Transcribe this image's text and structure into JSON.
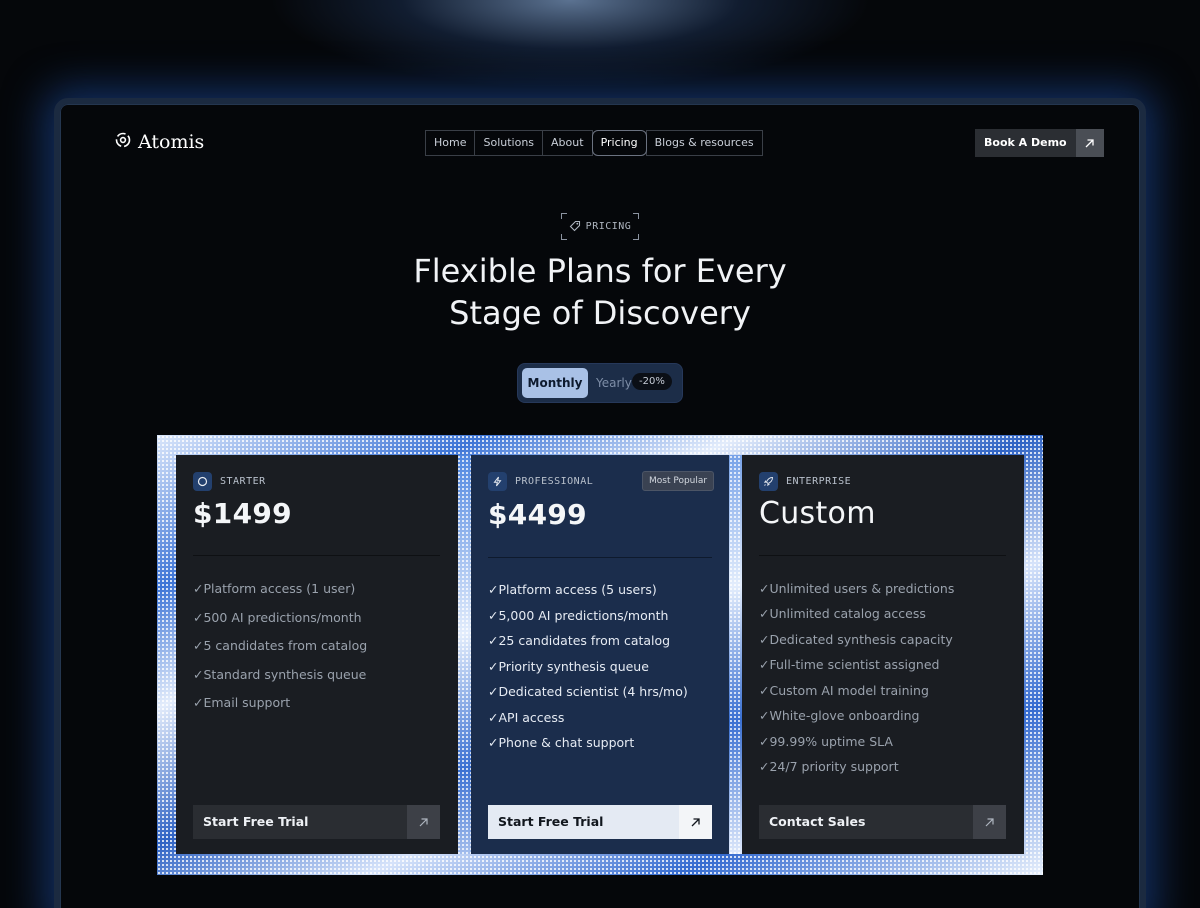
{
  "brand": {
    "name": "Atomis"
  },
  "nav": {
    "items": [
      "Home",
      "Solutions",
      "About",
      "Pricing",
      "Blogs & resources"
    ],
    "active": "Pricing"
  },
  "header_cta": {
    "label": "Book A Demo"
  },
  "hero": {
    "eyebrow": "PRICING",
    "title_line1": "Flexible Plans for Every",
    "title_line2": "Stage of Discovery"
  },
  "billing_toggle": {
    "monthly": "Monthly",
    "yearly": "Yearly",
    "yearly_badge": "-20%",
    "selected": "Monthly"
  },
  "plans": [
    {
      "name": "STARTER",
      "price": "$1499",
      "badge": "",
      "icon": "circle-icon",
      "features": [
        "Platform access (1 user)",
        "500 AI predictions/month",
        "5 candidates from catalog",
        "Standard synthesis queue",
        "Email support"
      ],
      "cta": "Start Free Trial"
    },
    {
      "name": "PROFESSIONAL",
      "price": "$4499",
      "badge": "Most Popular",
      "icon": "lightning-icon",
      "features": [
        "Platform access (5 users)",
        "5,000 AI predictions/month",
        "25 candidates from catalog",
        "Priority synthesis queue",
        "Dedicated scientist (4 hrs/mo)",
        "API access",
        "Phone & chat support"
      ],
      "cta": "Start Free Trial"
    },
    {
      "name": "ENTERPRISE",
      "price": "Custom",
      "badge": "",
      "icon": "rocket-icon",
      "features": [
        "Unlimited users & predictions",
        "Unlimited catalog access",
        "Dedicated synthesis capacity",
        "Full-time scientist assigned",
        "Custom AI model training",
        "White-glove onboarding",
        "99.99% uptime SLA",
        "24/7 priority support"
      ],
      "cta": "Contact Sales"
    }
  ],
  "check_glyph": "✓",
  "colors": {
    "accent": "#a9c1e6",
    "background": "#05070a",
    "card": "#1a1d22",
    "card_featured": "#1b2d4c",
    "glow": "#1e50aa"
  }
}
